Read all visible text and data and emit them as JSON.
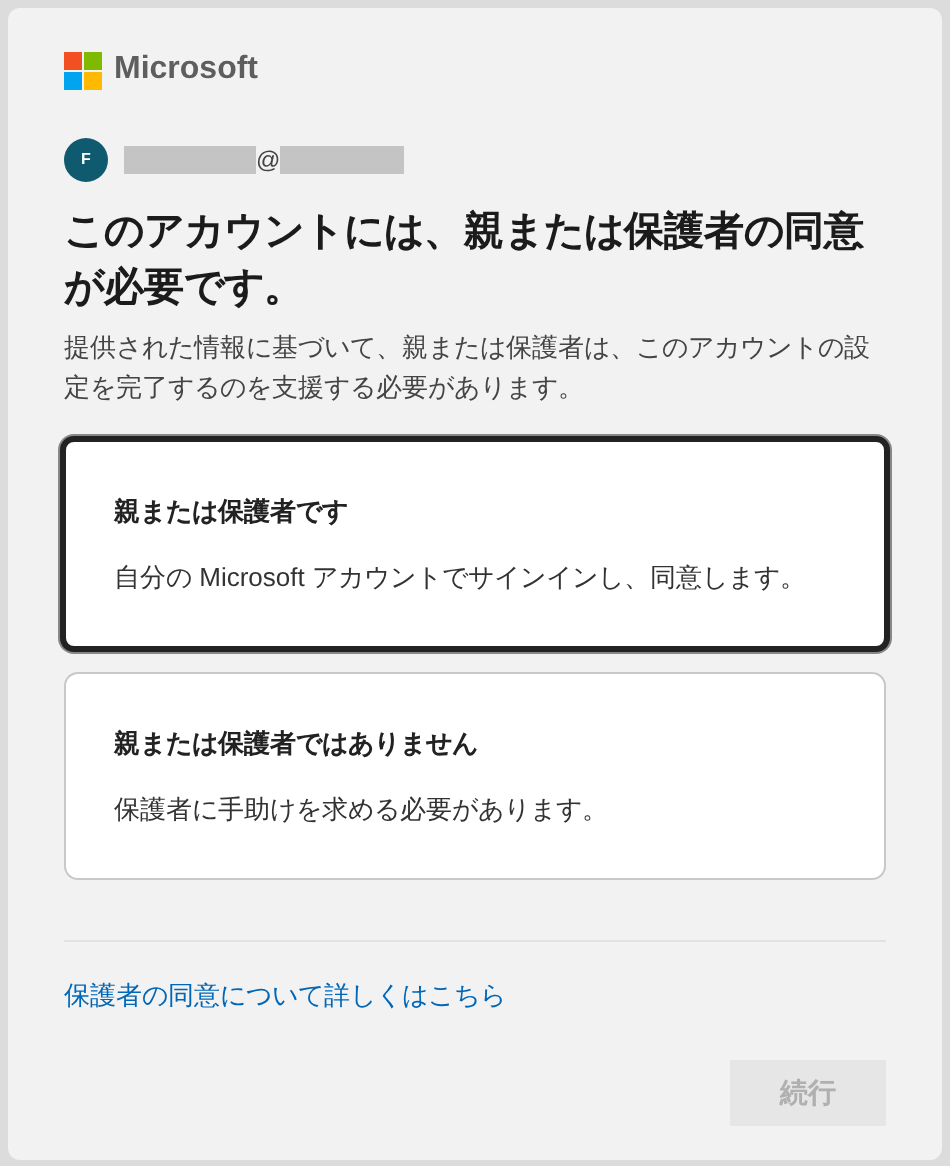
{
  "brand": {
    "name": "Microsoft"
  },
  "account": {
    "avatar_initial": "F",
    "separator": "@"
  },
  "title": "このアカウントには、親または保護者の同意が必要です。",
  "description": "提供された情報に基づいて、親または保護者は、このアカウントの設定を完了するのを支援する必要があります。",
  "options": [
    {
      "title": "親または保護者です",
      "subtitle": "自分の Microsoft アカウントでサインインし、同意します。",
      "selected": true
    },
    {
      "title": "親または保護者ではありません",
      "subtitle": "保護者に手助けを求める必要があります。",
      "selected": false
    }
  ],
  "link": "保護者の同意について詳しくはこちら",
  "continue_button": {
    "label": "続行",
    "disabled": true
  }
}
